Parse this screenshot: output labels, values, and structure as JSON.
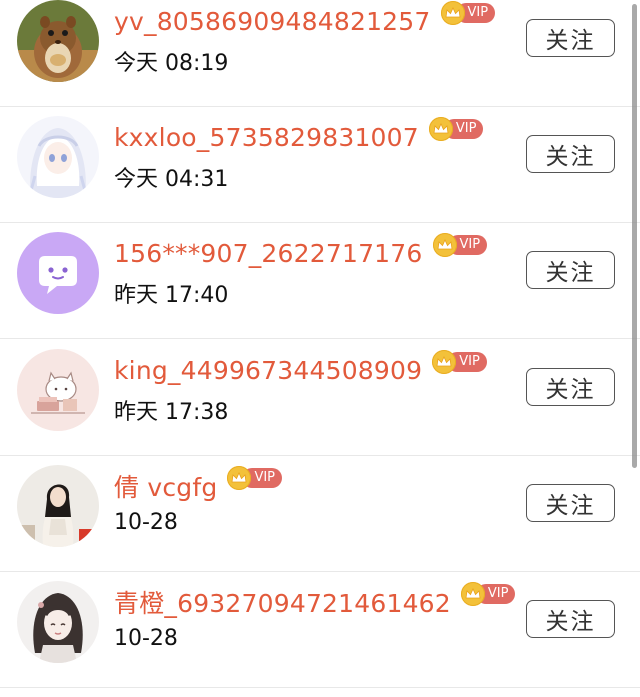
{
  "follow_label": "关注",
  "vip_label": "VIP",
  "colors": {
    "username": "#e25a3b",
    "vip_pill": "#e06a62",
    "vip_crown": "#f3c13a"
  },
  "users": [
    {
      "name": "yv_80586909484821257",
      "time": "今天 08:19",
      "avatar": "chipmunk-photo"
    },
    {
      "name": "kxxloo_5735829831007",
      "time": "今天 04:31",
      "avatar": "anime-girl-white"
    },
    {
      "name": "156***907_2622717176",
      "time": "昨天 17:40",
      "avatar": "purple-chat-bubble"
    },
    {
      "name": "king_449967344508909",
      "time": "昨天 17:38",
      "avatar": "pink-cat-cartoon"
    },
    {
      "name": "倩 vcgfg",
      "time": "10-28",
      "avatar": "woman-portrait"
    },
    {
      "name": "青橙_69327094721461462",
      "time": "10-28",
      "avatar": "anime-sketch"
    }
  ]
}
